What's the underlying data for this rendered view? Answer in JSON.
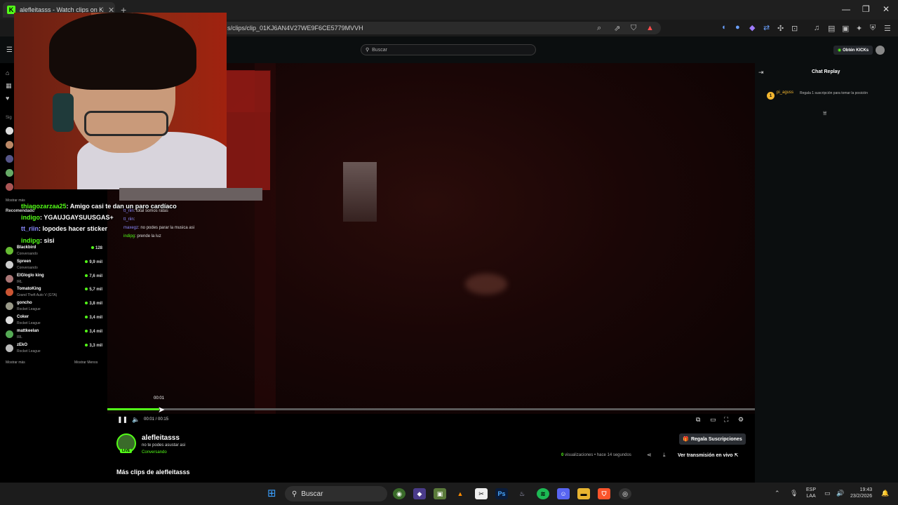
{
  "browser": {
    "tab_title": "alefleitasss - Watch clips on Ki",
    "tab_favicon": "K",
    "url": "s/clips/clip_01KJ6AN4V27WE9F6CE5779MVVH"
  },
  "kick": {
    "search_placeholder": "Buscar",
    "kicks_button": "Obtén KICKs",
    "chat_title": "Chat Replay",
    "pinned": {
      "badge": "1",
      "user": "pi_aguss",
      "text": "Regala 1 suscripción para tomar la posición"
    },
    "video": {
      "hover_time": "00:01",
      "timecode": "00:01 / 00:15",
      "progress": 0.08
    },
    "channel": {
      "name": "alefleitasss",
      "live_badge": "LIVE",
      "clip_title": "no te podes asustar asi",
      "category": "Conversando",
      "gift_button": "Regala Suscripciones",
      "views_count": "0",
      "views_text": "visualizaciones • hace 14 segundos",
      "watch_live": "Ver transmisión en vivo",
      "more_clips": "Más clips de alefleitasss"
    }
  },
  "sidebar": {
    "show_more_top": "Mostrar más",
    "recommended_label": "Recomendado",
    "show_more": "Mostrar más",
    "show_less": "Mostrar Menos",
    "recommended": [
      {
        "name": "Blackbird",
        "category": "Conversando",
        "viewers": "128"
      },
      {
        "name": "Spreen",
        "category": "Conversando",
        "viewers": "9,9 mil"
      },
      {
        "name": "ElGloglo king",
        "category": "IRL",
        "viewers": "7,6 mil"
      },
      {
        "name": "TomatoKing",
        "category": "Grand Theft Auto V (GTA)",
        "viewers": "5,7 mil"
      },
      {
        "name": "goncho",
        "category": "Rocket League",
        "viewers": "3,8 mil"
      },
      {
        "name": "Coker",
        "category": "Rocket League",
        "viewers": "3,4 mil"
      },
      {
        "name": "mattkeelan",
        "category": "IRL",
        "viewers": "3,4 mil"
      },
      {
        "name": "zEkO",
        "category": "Rocket League",
        "viewers": "3,3 mil"
      }
    ]
  },
  "stream_chat_overlay": {
    "big": [
      {
        "user": "thiagozarzaa25",
        "text": ": Amigo casi te dan un paro cardíaco"
      },
      {
        "user": "indigo",
        "text": ": YGAUJGAYSUUSGAS+"
      },
      {
        "user": "tt_riin",
        "text": ": lopodes hacer sticker"
      },
      {
        "user": "indipg",
        "text": ": sisi"
      }
    ],
    "small": [
      {
        "user": "tt_riin",
        "text": ": total somos ratas"
      },
      {
        "user": "tt_riin",
        "text": ":"
      },
      {
        "user": "maxegz",
        "text": ": no podes parar la musica asi"
      },
      {
        "user": "indipg",
        "text": ": prende la luz"
      }
    ]
  },
  "taskbar": {
    "search": "Buscar",
    "lang_1": "ESP",
    "lang_2": "LAA",
    "time": "19:43",
    "date": "23/2/2026"
  },
  "colors": {
    "kick_green": "#53fc18",
    "bg": "#0b0e0f",
    "gold": "#f2b630"
  }
}
